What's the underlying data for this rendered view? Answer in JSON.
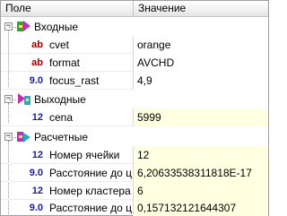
{
  "header": {
    "col_name": "Поле",
    "col_value": "Значение"
  },
  "groups": [
    {
      "label": "Входные",
      "icon": "input-group-icon",
      "expander": "−"
    },
    {
      "label": "Выходные",
      "icon": "output-group-icon",
      "expander": "−"
    },
    {
      "label": "Расчетные",
      "icon": "calc-group-icon",
      "expander": "−"
    }
  ],
  "props": [
    {
      "type": "ab",
      "name": "cvet",
      "value": "orange"
    },
    {
      "type": "ab",
      "name": "format",
      "value": "AVCHD"
    },
    {
      "type": "9.0",
      "name": "focus_rast",
      "value": "4,9"
    },
    {
      "type": "12",
      "name": "cena",
      "value": "5999"
    },
    {
      "type": "12",
      "name": "Номер ячейки",
      "value": "12"
    },
    {
      "type": "9.0",
      "name": "Расстояние до ц...",
      "value": "6,20633538311818E-17"
    },
    {
      "type": "12",
      "name": "Номер кластера",
      "value": "6"
    },
    {
      "type": "9.0",
      "name": "Расстояние до ц...",
      "value": "0,157132121644307"
    }
  ],
  "colors": {
    "readonly_bg": "#ffffe1",
    "type_text": "#a00000",
    "type_num": "#1a1aa8",
    "header_bg": "#f0f0f0"
  }
}
